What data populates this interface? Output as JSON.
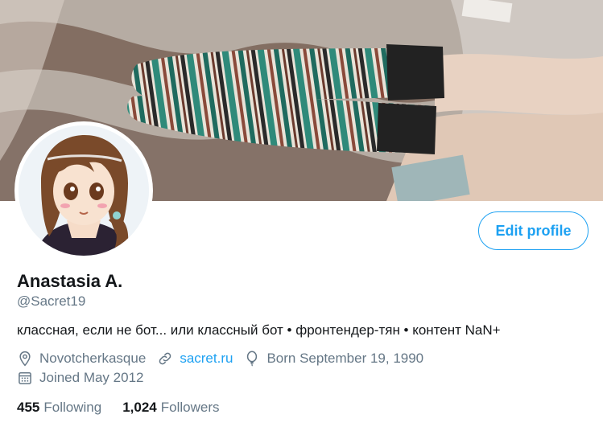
{
  "banner": {
    "image": "striped-socks-photo"
  },
  "avatar": {
    "image": "anime-girl-avatar"
  },
  "edit_profile": {
    "label": "Edit profile"
  },
  "profile": {
    "name": "Anastasia A.",
    "handle": "@Sacret19",
    "bio": "классная, если не бот... или классный бот • фронтендер-тян • контент NaN+",
    "location": "Novotcherkasque",
    "website": "sacret.ru",
    "birthday": "Born September 19, 1990",
    "joined": "Joined May 2012"
  },
  "stats": {
    "following_count": "455",
    "following_label": "Following",
    "followers_count": "1,024",
    "followers_label": "Followers"
  },
  "colors": {
    "accent": "#1da1f2",
    "secondary_text": "#657786",
    "primary_text": "#14171a"
  },
  "icons": [
    "location-icon",
    "link-icon",
    "balloon-icon",
    "calendar-icon"
  ]
}
